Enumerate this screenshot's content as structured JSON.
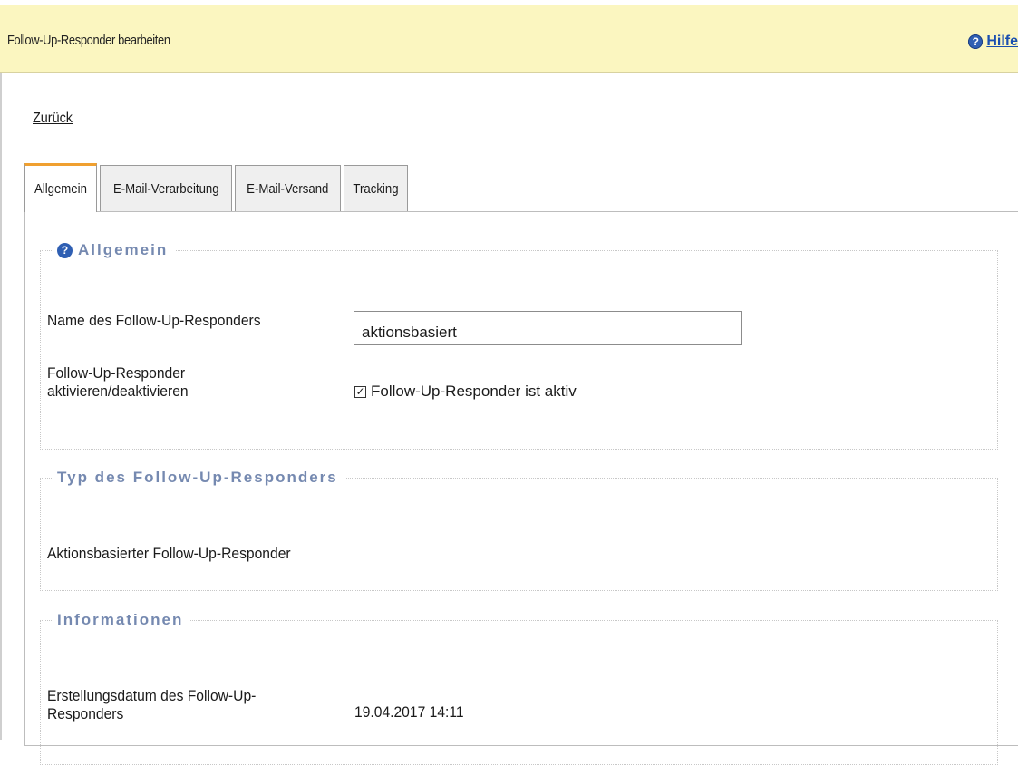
{
  "header": {
    "title": "Follow-Up-Responder bearbeiten",
    "help_label": "Hilfe"
  },
  "back_link": "Zurück",
  "tabs": [
    {
      "label": "Allgemein",
      "active": true
    },
    {
      "label": "E-Mail-Verarbeitung",
      "active": false
    },
    {
      "label": "E-Mail-Versand",
      "active": false
    },
    {
      "label": "Tracking",
      "active": false
    }
  ],
  "sections": {
    "general": {
      "legend": "Allgemein",
      "name_label": "Name des Follow-Up-Responders",
      "name_value": "aktionsbasiert",
      "toggle_label_line1": "Follow-Up-Responder",
      "toggle_label_line2": "aktivieren/deaktivieren",
      "toggle_checkbox_label": "Follow-Up-Responder ist aktiv",
      "toggle_checked": true
    },
    "type": {
      "legend": "Typ des Follow-Up-Responders",
      "value": "Aktionsbasierter Follow-Up-Responder"
    },
    "info": {
      "legend": "Informationen",
      "created_label_line1": "Erstellungsdatum des Follow-Up-",
      "created_label_line2": "Responders",
      "created_value": "19.04.2017 14:11"
    }
  },
  "colors": {
    "header_bg": "#fbf6c0",
    "legend_text": "#7589b0",
    "active_tab_accent": "#f0a030",
    "link_blue": "#1a4fb0"
  },
  "icons": {
    "help": "question-circle-icon",
    "section_help": "question-circle-icon"
  }
}
